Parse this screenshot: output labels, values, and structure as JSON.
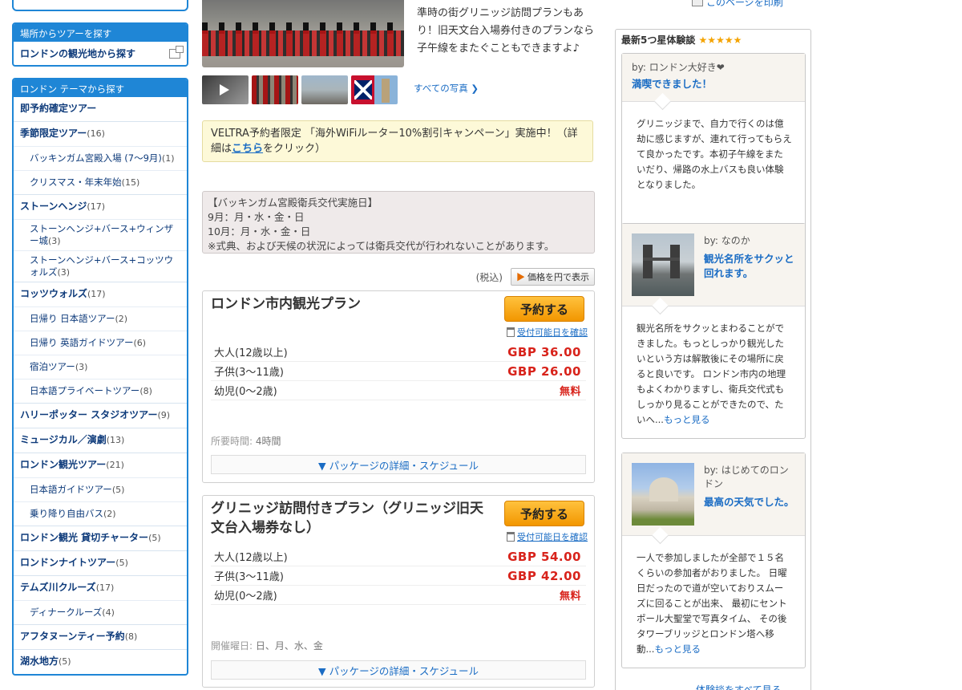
{
  "sidebar": {
    "location_box": {
      "header": "場所からツアーを探す",
      "link": "ロンドンの観光地から探す"
    },
    "theme_box": {
      "header": "ロンドン テーマから探す",
      "categories": [
        {
          "label": "即予約確定ツアー",
          "count": "",
          "subs": []
        },
        {
          "label": "季節限定ツアー",
          "count": "(16)",
          "subs": [
            {
              "label": "バッキンガム宮殿入場 (7～9月)",
              "count": "(1)"
            },
            {
              "label": "クリスマス・年末年始",
              "count": "(15)"
            }
          ]
        },
        {
          "label": "ストーンヘンジ",
          "count": "(17)",
          "subs": [
            {
              "label": "ストーンヘンジ+バース+ウィンザー城",
              "count": "(3)"
            },
            {
              "label": "ストーンヘンジ+バース+コッツウォルズ",
              "count": "(3)"
            }
          ]
        },
        {
          "label": "コッツウォルズ",
          "count": "(17)",
          "subs": [
            {
              "label": "日帰り 日本語ツアー",
              "count": "(2)"
            },
            {
              "label": "日帰り 英語ガイドツアー",
              "count": "(6)"
            },
            {
              "label": "宿泊ツアー",
              "count": "(3)"
            },
            {
              "label": "日本語プライベートツアー",
              "count": "(8)"
            }
          ]
        },
        {
          "label": "ハリーポッター スタジオツアー",
          "count": "(9)",
          "subs": []
        },
        {
          "label": "ミュージカル／演劇",
          "count": "(13)",
          "subs": []
        },
        {
          "label": "ロンドン観光ツアー",
          "count": "(21)",
          "subs": [
            {
              "label": "日本語ガイドツアー",
              "count": "(5)"
            },
            {
              "label": "乗り降り自由バス",
              "count": "(2)"
            }
          ]
        },
        {
          "label": "ロンドン観光 貸切チャーター",
          "count": "(5)",
          "subs": []
        },
        {
          "label": "ロンドンナイトツアー",
          "count": "(5)",
          "subs": []
        },
        {
          "label": "テムズ川クルーズ",
          "count": "(17)",
          "subs": [
            {
              "label": "ディナークルーズ",
              "count": "(4)"
            }
          ]
        },
        {
          "label": "アフタヌーンティー予約",
          "count": "(8)",
          "subs": []
        },
        {
          "label": "湖水地方",
          "count": "(5)",
          "subs": []
        }
      ]
    }
  },
  "main": {
    "hero_text": "準時の街グリニッジ訪問プランもあり！旧天文台入場券付きのプランなら子午線をまたぐこともできますよ♪",
    "all_photos": "すべての写真",
    "promo": {
      "before": "VELTRA予約者限定 「海外WiFiルーター10%割引キャンペーン」実施中！（詳細は",
      "link": "こちら",
      "after": "をクリック）"
    },
    "notice": {
      "line1": "【バッキンガム宮殿衛兵交代実施日】",
      "line2": "9月：月・水・金・日",
      "line3": "10月：月・水・金・日",
      "line4": "※式典、および天候の状況によっては衛兵交代が行われないことがあります。"
    },
    "tax_label": "(税込)",
    "yen_button": "価格を円で表示",
    "plans": [
      {
        "title": "ロンドン市内観光プラン",
        "book_label": "予約する",
        "availability": "受付可能日を確認",
        "prices": [
          {
            "label": "大人(12歳以上)",
            "price": "GBP 36.00"
          },
          {
            "label": "子供(3～11歳)",
            "price": "GBP 26.00"
          },
          {
            "label": "幼児(0～2歳)",
            "price": "無料"
          }
        ],
        "meta_label": "所要時間:",
        "meta_value": "4時間",
        "detail_label": "▼ パッケージの詳細・スケジュール"
      },
      {
        "title": "グリニッジ訪問付きプラン（グリニッジ旧天文台入場券なし）",
        "book_label": "予約する",
        "availability": "受付可能日を確認",
        "prices": [
          {
            "label": "大人(12歳以上)",
            "price": "GBP 54.00"
          },
          {
            "label": "子供(3～11歳)",
            "price": "GBP 42.00"
          },
          {
            "label": "幼児(0～2歳)",
            "price": "無料"
          }
        ],
        "meta_label": "開催曜日:",
        "meta_value": "日、月、水、金",
        "detail_label": "▼ パッケージの詳細・スケジュール"
      }
    ]
  },
  "right": {
    "print_link": "このページを印刷",
    "reviews_header": "最新5つ星体験談",
    "stars": "★★★★★",
    "reviews": [
      {
        "by": "by: ロンドン大好き❤",
        "title": "満喫できました！",
        "body": "グリニッジまで、自力で行くのは億劫に感じますが、連れて行ってもらえて良かったです。本初子午線をまたいだり、帰路の水上バスも良い体験となりました。",
        "more": ""
      },
      {
        "by": "by: なのか",
        "title": "観光名所をサクッと回れます。",
        "body": "観光名所をサクッとまわることができました。もっとしっかり観光したいという方は解散後にその場所に戻ると良いです。 ロンドン市内の地理もよくわかりますし、衛兵交代式もしっかり見ることができたので、たいへ...",
        "more": "もっと見る"
      },
      {
        "by": "by: はじめてのロンドン",
        "title": "最高の天気でした。",
        "body": "一人で参加しましたが全部で１５名くらいの参加者がおりました。 日曜日だったので道が空いておりスムーズに回ることが出来、 最初にセントポール大聖堂で写真タイム、 その後タワーブリッジとロンドン塔へ移動...",
        "more": "もっと見る"
      }
    ],
    "all_reviews": "体験談をすべて見る"
  }
}
